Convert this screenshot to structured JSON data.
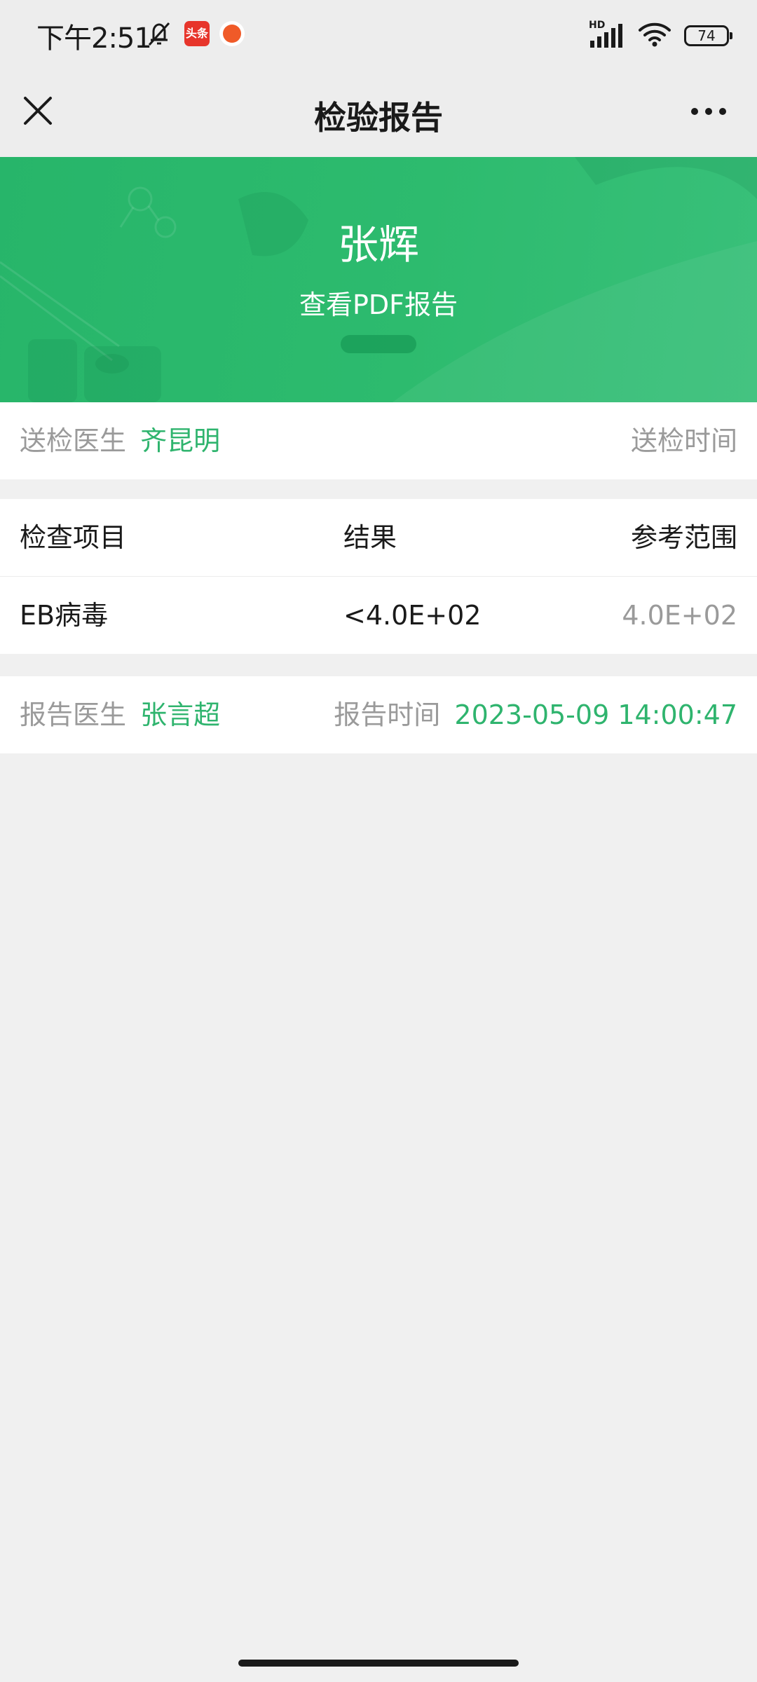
{
  "status_bar": {
    "time": "下午2:51",
    "toutiao_label": "头条",
    "signal_label": "HD",
    "battery": "74"
  },
  "nav": {
    "title": "检验报告"
  },
  "banner": {
    "patient_name": "张辉",
    "pdf_link": "查看PDF报告"
  },
  "submit_info": {
    "doctor_label": "送检医生",
    "doctor_name": "齐昆明",
    "time_label": "送检时间"
  },
  "results_table": {
    "headers": [
      "检查项目",
      "结果",
      "参考范围"
    ],
    "rows": [
      {
        "item": "EB病毒",
        "result": "<4.0E+02",
        "range": "4.0E+02"
      }
    ]
  },
  "report_info": {
    "doctor_label": "报告医生",
    "doctor_name": "张言超",
    "time_label": "报告时间",
    "time_value": "2023-05-09 14:00:47"
  },
  "colors": {
    "accent": "#2fb46e",
    "banner": "#2dbb6e",
    "background": "#f0f0f0"
  }
}
